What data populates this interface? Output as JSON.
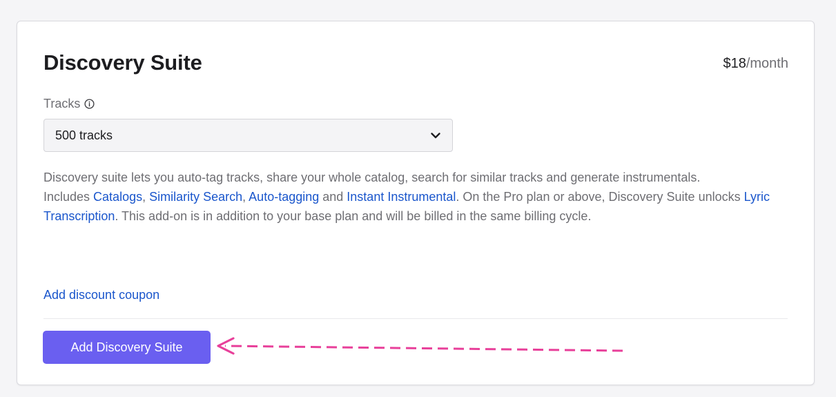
{
  "card": {
    "title": "Discovery Suite",
    "price": {
      "amount": "$18",
      "period": "/month"
    },
    "tracks": {
      "label": "Tracks",
      "selected": "500 tracks"
    },
    "description": {
      "line1": "Discovery suite lets you auto-tag tracks, share your whole catalog, search for similar tracks and generate instrumentals.",
      "includes_prefix": "Includes ",
      "links": [
        "Catalogs",
        "Similarity Search",
        "Auto-tagging",
        "Instant Instrumental",
        "Lyric Transcription"
      ],
      "sep_comma": ", ",
      "sep_and": " and ",
      "pro_text": ". On the Pro plan or above, Discovery Suite unlocks ",
      "tail_text": ". This add-on is in addition to your base plan and will be billed in the same billing cycle."
    },
    "coupon_link": "Add discount coupon",
    "add_button": "Add Discovery Suite"
  },
  "colors": {
    "accent_button": "#6a5ff0",
    "link": "#1a56cc",
    "annotation_arrow": "#e8409a"
  },
  "icons": {
    "info": "info-circle-icon",
    "dropdown": "chevron-down-icon",
    "annotation": "dashed-arrow-left-icon"
  }
}
